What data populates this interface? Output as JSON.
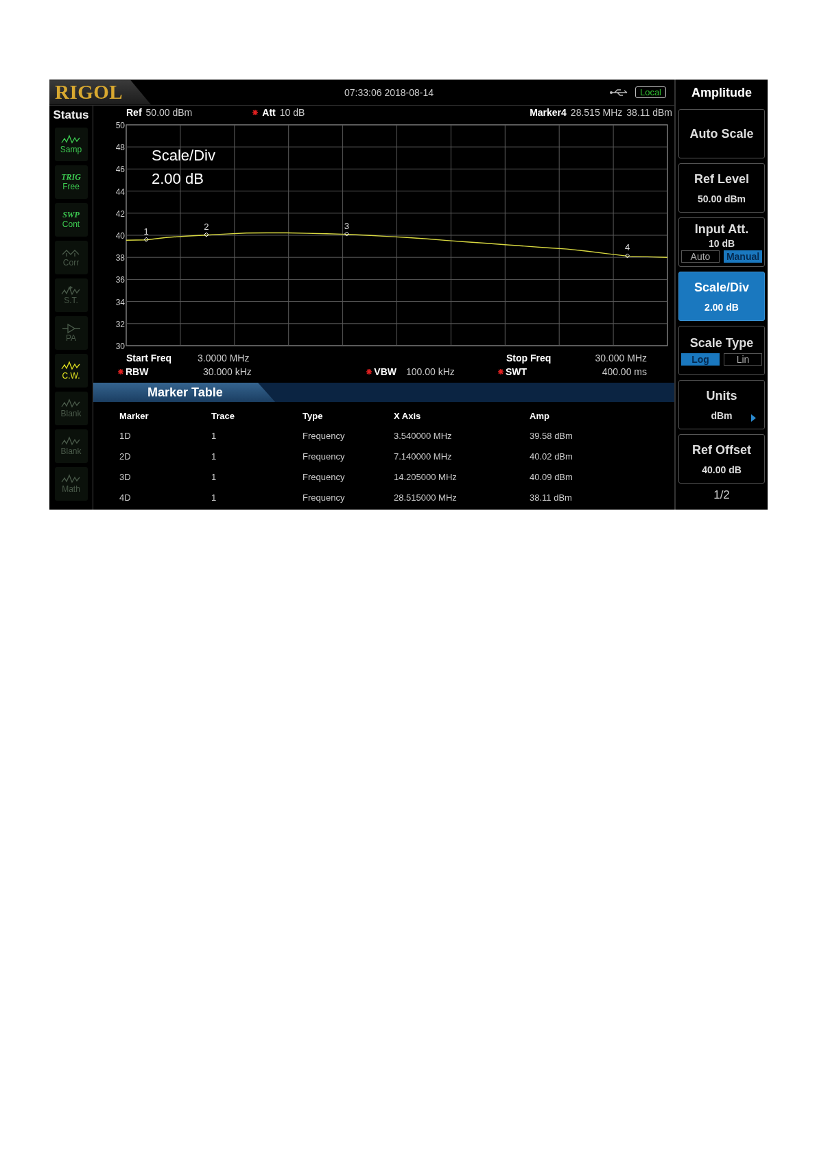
{
  "header": {
    "logo": "RIGOL",
    "datetime": "07:33:06 2018-08-14",
    "remote": "Local"
  },
  "status": {
    "title": "Status",
    "items": [
      {
        "kind": "wave",
        "label": "Samp",
        "on": true,
        "color": "#3cc850"
      },
      {
        "kind": "text",
        "top": "TRIG",
        "label": "Free",
        "on": true,
        "color": "#3cc850"
      },
      {
        "kind": "text",
        "top": "SWP",
        "label": "Cont",
        "on": true,
        "color": "#3cc850"
      },
      {
        "kind": "corr",
        "label": "Corr",
        "on": false
      },
      {
        "kind": "plus",
        "label": "S.T.",
        "on": false
      },
      {
        "kind": "amp",
        "label": "PA",
        "on": false
      },
      {
        "kind": "wave",
        "label": "C.W.",
        "on": true,
        "color": "#e0e020"
      },
      {
        "kind": "wave",
        "label": "Blank",
        "on": false
      },
      {
        "kind": "wave",
        "label": "Blank",
        "on": false
      },
      {
        "kind": "wave",
        "label": "Math",
        "on": false
      }
    ]
  },
  "readout": {
    "ref": {
      "label": "Ref",
      "value": "50.00 dBm"
    },
    "att": {
      "label": "Att",
      "value": "10 dB",
      "manual": true
    },
    "marker": {
      "label": "Marker4",
      "x": "28.515 MHz",
      "y": "38.11 dBm"
    }
  },
  "overlay": {
    "title": "Scale/Div",
    "value": "2.00 dB"
  },
  "chart_data": {
    "type": "line",
    "ylim": [
      30,
      50
    ],
    "yticks": [
      30,
      32,
      34,
      36,
      38,
      40,
      42,
      44,
      46,
      48,
      50
    ],
    "categories": [
      null,
      null,
      null,
      null,
      null,
      null,
      null,
      null,
      null,
      null,
      null,
      null,
      null,
      null,
      null,
      null,
      null,
      null,
      null,
      null,
      null,
      null,
      null,
      null,
      null,
      null,
      null,
      null
    ],
    "series": [
      {
        "color": "#d8d840",
        "values": [
          39.55,
          39.58,
          39.8,
          39.92,
          40.02,
          40.12,
          40.2,
          40.22,
          40.22,
          40.18,
          40.14,
          40.09,
          40.0,
          39.9,
          39.8,
          39.67,
          39.53,
          39.4,
          39.27,
          39.13,
          39.0,
          38.87,
          38.75,
          38.55,
          38.33,
          38.11,
          38.05,
          38.0
        ]
      }
    ],
    "grid": true,
    "annotations": [
      {
        "y": 39.58,
        "text": "1"
      },
      {
        "y": 40.02,
        "text": "2"
      },
      {
        "y": 40.09,
        "text": "3"
      },
      {
        "y": 38.11,
        "text": "4"
      }
    ]
  },
  "sweep": {
    "start": {
      "label": "Start Freq",
      "value": "3.0000 MHz"
    },
    "stop": {
      "label": "Stop Freq",
      "value": "30.000 MHz"
    },
    "bandwidth": [
      {
        "label": "RBW",
        "value": "30.000 kHz",
        "manual": true
      },
      {
        "label": "VBW",
        "value": "100.00 kHz",
        "manual": true
      },
      {
        "label": "SWT",
        "value": "400.00 ms",
        "manual": true
      }
    ]
  },
  "marker_table": {
    "title": "Marker Table",
    "columns": [
      "Marker",
      "Trace",
      "Type",
      "X Axis",
      "Amp"
    ],
    "rows": [
      [
        "1D",
        "1",
        "Frequency",
        "3.540000 MHz",
        "39.58 dBm"
      ],
      [
        "2D",
        "1",
        "Frequency",
        "7.140000 MHz",
        "40.02 dBm"
      ],
      [
        "3D",
        "1",
        "Frequency",
        "14.205000 MHz",
        "40.09 dBm"
      ],
      [
        "4D",
        "1",
        "Frequency",
        "28.515000 MHz",
        "38.11 dBm"
      ]
    ]
  },
  "menu": {
    "title": "Amplitude",
    "page": "1/2",
    "items": [
      {
        "kind": "action",
        "label": "Auto Scale",
        "selected": false
      },
      {
        "kind": "value",
        "label": "Ref Level",
        "value": "50.00 dBm",
        "selected": false
      },
      {
        "kind": "toggle",
        "label": "Input Att.",
        "value": "10 dB",
        "selected": false,
        "options": [
          {
            "label": "Auto",
            "selected": false
          },
          {
            "label": "Manual",
            "selected": true
          }
        ]
      },
      {
        "kind": "value",
        "label": "Scale/Div",
        "value": "2.00 dB",
        "selected": true
      },
      {
        "kind": "toggle",
        "label": "Scale Type",
        "selected": false,
        "options": [
          {
            "label": "Log",
            "selected": true
          },
          {
            "label": "Lin",
            "selected": false
          }
        ]
      },
      {
        "kind": "submenu",
        "label": "Units",
        "value": "dBm",
        "selected": false
      },
      {
        "kind": "value",
        "label": "Ref Offset",
        "value": "40.00 dB",
        "selected": false
      }
    ]
  }
}
